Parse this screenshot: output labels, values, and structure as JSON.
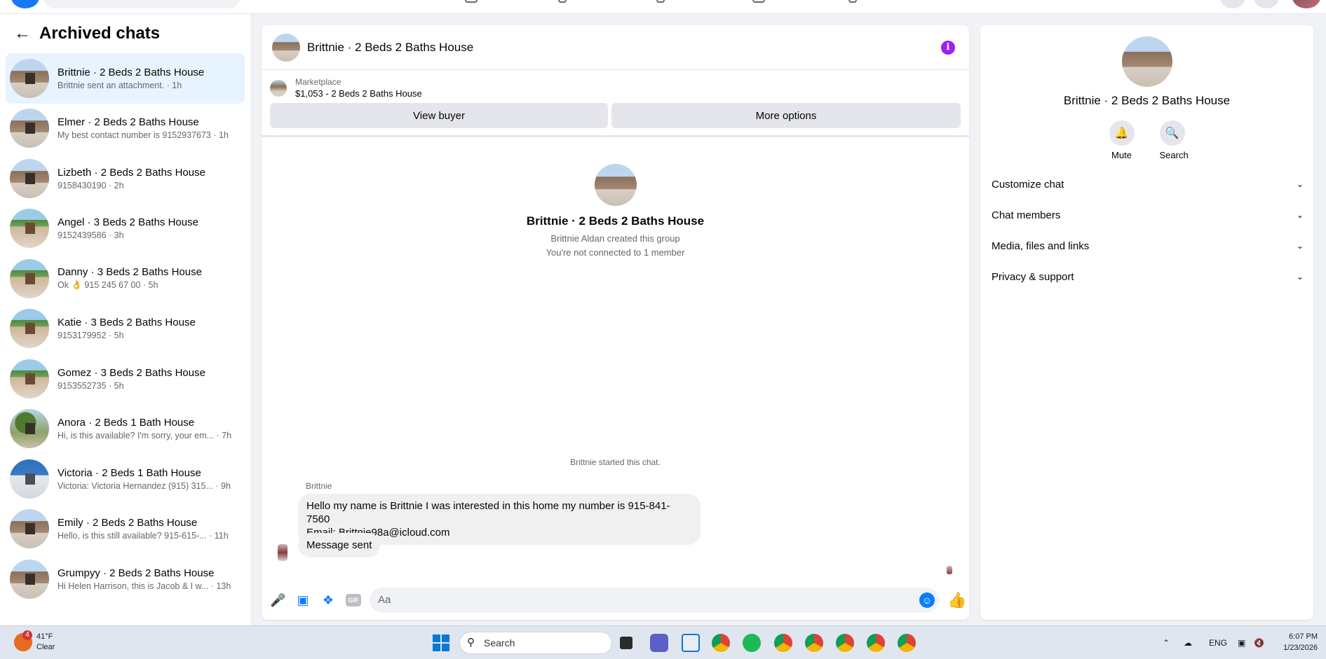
{
  "sidebar": {
    "title": "Archived chats",
    "chats": [
      {
        "name": "Brittnie · 2 Beds 2 Baths House",
        "preview": "Brittnie sent an attachment. · 1h"
      },
      {
        "name": "Elmer · 2 Beds 2 Baths House",
        "preview": "My best contact number is 9152937673 · 1h"
      },
      {
        "name": "Lizbeth · 2 Beds 2 Baths House",
        "preview": "9158430190 · 2h"
      },
      {
        "name": "Angel · 3 Beds 2 Baths House",
        "preview": "9152439586 · 3h"
      },
      {
        "name": "Danny · 3 Beds 2 Baths House",
        "preview": "Ok 👌 915 245 67 00 · 5h"
      },
      {
        "name": "Katie · 3 Beds 2 Baths House",
        "preview": "9153179952 · 5h"
      },
      {
        "name": "Gomez · 3 Beds 2 Baths House",
        "preview": "9153552735 · 5h"
      },
      {
        "name": "Anora · 2 Beds 1 Bath House",
        "preview": "Hi, is this available? I'm sorry, your em... · 7h"
      },
      {
        "name": "Victoria · 2 Beds 1 Bath House",
        "preview": "Victoria: Victoria Hernandez (915) 315... · 9h"
      },
      {
        "name": "Emily · 2 Beds 2 Baths House",
        "preview": "Hello, is this still available? 915-615-... · 11h"
      },
      {
        "name": "Grumpyy · 2 Beds 2 Baths House",
        "preview": "Hi Helen Harrison, this is Jacob & I w... · 13h"
      }
    ]
  },
  "conversation": {
    "title": "Brittnie · 2 Beds 2 Baths House",
    "info_glyph": "i",
    "marketplace_label": "Marketplace",
    "listing": "$1,053 - 2 Beds 2 Baths House",
    "view_buyer": "View buyer",
    "more_options": "More options",
    "intro_name": "Brittnie · 2 Beds 2 Baths House",
    "intro_created": "Brittnie Aldan created this group",
    "intro_connected": "You're not connected to 1 member",
    "started": "Brittnie started this chat.",
    "sender": "Brittnie",
    "message_line1": "Hello my name is Brittnie I was interested in this home  my number is 915-841-7560",
    "message_line2": "Email: Brittnie98a@icloud.com",
    "message_sent": "Message sent",
    "composer_placeholder": "Aa",
    "gif_label": "GIF"
  },
  "info_panel": {
    "name": "Brittnie · 2 Beds 2 Baths House",
    "mute": "Mute",
    "search": "Search",
    "sections": [
      "Customize chat",
      "Chat members",
      "Media, files and links",
      "Privacy & support"
    ]
  },
  "taskbar": {
    "weather_badge": "4",
    "temperature": "41°F",
    "condition": "Clear",
    "search": "Search",
    "language": "ENG",
    "time": "6:07 PM",
    "date": "1/23/2026"
  },
  "colors": {
    "accent": "#0a7cff",
    "info": "#a020f0",
    "active_chat": "#e7f3ff"
  }
}
